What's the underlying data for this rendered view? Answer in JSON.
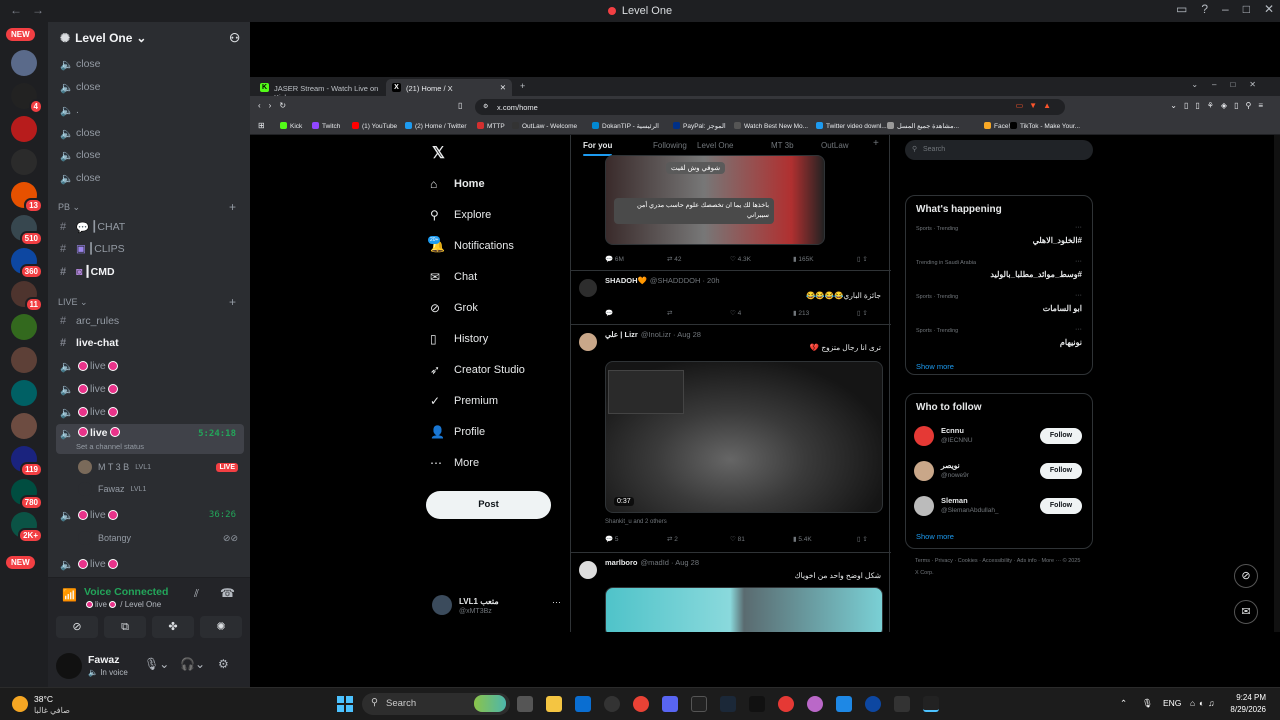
{
  "titlebar": {
    "title": "Level One"
  },
  "rail": {
    "new_top": "NEW",
    "new_bottom": "NEW",
    "servers": [
      {
        "badge": ""
      },
      {
        "badge": "4"
      },
      {
        "badge": ""
      },
      {
        "badge": ""
      },
      {
        "badge": "13"
      },
      {
        "badge": "510"
      },
      {
        "badge": "360"
      },
      {
        "badge": "11"
      },
      {
        "badge": ""
      },
      {
        "badge": ""
      },
      {
        "badge": ""
      },
      {
        "badge": ""
      },
      {
        "badge": "119"
      },
      {
        "badge": "780"
      },
      {
        "badge": "2K+"
      }
    ]
  },
  "sidebar": {
    "guild_name": "Level One",
    "close_channels": [
      "close",
      "close",
      ".",
      "close",
      "close",
      "close"
    ],
    "cat_pb": "PB",
    "pb_channels": [
      "┃CHAT",
      "┃CLIPS",
      "┃CMD"
    ],
    "cat_live": "LIVE",
    "live_text": [
      "arc_rules",
      "live-chat"
    ],
    "voice_label": "live",
    "channel_status": "Set a channel status",
    "timer1": "5:24:18",
    "timer2": "36:26",
    "users": [
      {
        "name": "M T 3 B",
        "tag": "LVL1",
        "live": "LIVE"
      },
      {
        "name": "Fawaz",
        "tag": "LVL1"
      }
    ],
    "user_botangy": "Botangy"
  },
  "voice": {
    "status": "Voice Connected",
    "channel": "/ Level One"
  },
  "user": {
    "name": "Fawaz",
    "status": "In voice"
  },
  "browser": {
    "tabs": [
      {
        "label": "JASER Stream - Watch Live on Kick"
      },
      {
        "label": "(21) Home / X"
      }
    ],
    "url": "x.com/home",
    "bookmarks": [
      "Kick",
      "Twitch",
      "(1) YouTube",
      "(2) Home / Twitter",
      "MTTP",
      "OutLaw - Welcome",
      "DokanTIP - الرئيسية",
      "PayPal: الموجز",
      "Watch Best New Mo...",
      "Twitter video downl...",
      "مشاهدة جميع المسل...",
      "Face!",
      "TikTok - Make Your..."
    ]
  },
  "x": {
    "nav": [
      {
        "label": "Home",
        "icon": "home-icon"
      },
      {
        "label": "Explore",
        "icon": "search-icon"
      },
      {
        "label": "Notifications",
        "icon": "bell-icon"
      },
      {
        "label": "Chat",
        "icon": "chat-icon"
      },
      {
        "label": "Grok",
        "icon": "grok-icon"
      },
      {
        "label": "History",
        "icon": "bookmark-icon"
      },
      {
        "label": "Creator Studio",
        "icon": "rocket-icon"
      },
      {
        "label": "Premium",
        "icon": "verified-icon"
      },
      {
        "label": "Profile",
        "icon": "person-icon"
      },
      {
        "label": "More",
        "icon": "more-icon"
      }
    ],
    "notif_badge": "20+",
    "post_label": "Post",
    "account": {
      "name": "LVL1 متعب",
      "handle": "@xMT3Bz"
    },
    "feed_tabs": [
      "For you",
      "Following",
      "Level One",
      "MT 3b",
      "OutLaw"
    ],
    "tweet0_caption1": "شوفي وش لقيت",
    "tweet0_caption2": "باخذها لك يما ان تخصصك علوم حاسب مدري أمن سيبراني",
    "tweet0_actions": [
      "6M",
      "42",
      "4.3K",
      "165K"
    ],
    "tweet1": {
      "name": "SHADOH🧡",
      "handle": "@SHADDDOH · 20h",
      "text": "جائزة الباري😂😂😂😂",
      "actions": [
        "",
        "",
        "4",
        "213"
      ]
    },
    "tweet2": {
      "name": "علي | Lizr",
      "handle": "@InoLizr · Aug 28",
      "text": "ترى انا رجال متزوج 💔",
      "duration": "0:37",
      "reposts": "Shankit_u and 2 others",
      "actions": [
        "5",
        "2",
        "81",
        "5.4K"
      ]
    },
    "tweet3": {
      "name": "marlboro",
      "handle": "@madId · Aug 28",
      "text": "شكل اوضح واحد من اخوياك"
    },
    "search_placeholder": "Search",
    "whats_happening": "What's happening",
    "trends": [
      {
        "meta": "Sports · Trending",
        "name": "#الخلود_الاهلي"
      },
      {
        "meta": "Trending in Saudi Arabia",
        "name": "#وسط_موائد_مطلبا_بالوليد"
      },
      {
        "meta": "Sports · Trending",
        "name": "ابو السامات"
      },
      {
        "meta": "Sports · Trending",
        "name": "نونيهام"
      }
    ],
    "show_more": "Show more",
    "who_to_follow": "Who to follow",
    "follow_list": [
      {
        "name": "Ecnnu",
        "handle": "@IECNNU",
        "btn": "Follow"
      },
      {
        "name": "نويصر",
        "handle": "@nowe9r",
        "btn": "Follow"
      },
      {
        "name": "Sleman",
        "handle": "@SlemanAbdullah_",
        "btn": "Follow"
      }
    ],
    "footer": "Terms  ·  Privacy  ·  Cookies  ·  Accessibility  ·  Ads info  ·  More ···  © 2025 X Corp."
  },
  "taskbar": {
    "temp": "38°C",
    "weather": "صافي غالبا",
    "search": "Search",
    "lang": "ENG",
    "time": "9:24 PM",
    "date": "8/29/2026"
  },
  "colors": {
    "accent": "#1d9bf0",
    "discord_green": "#23a55a",
    "live_pink": "#e8338a"
  }
}
